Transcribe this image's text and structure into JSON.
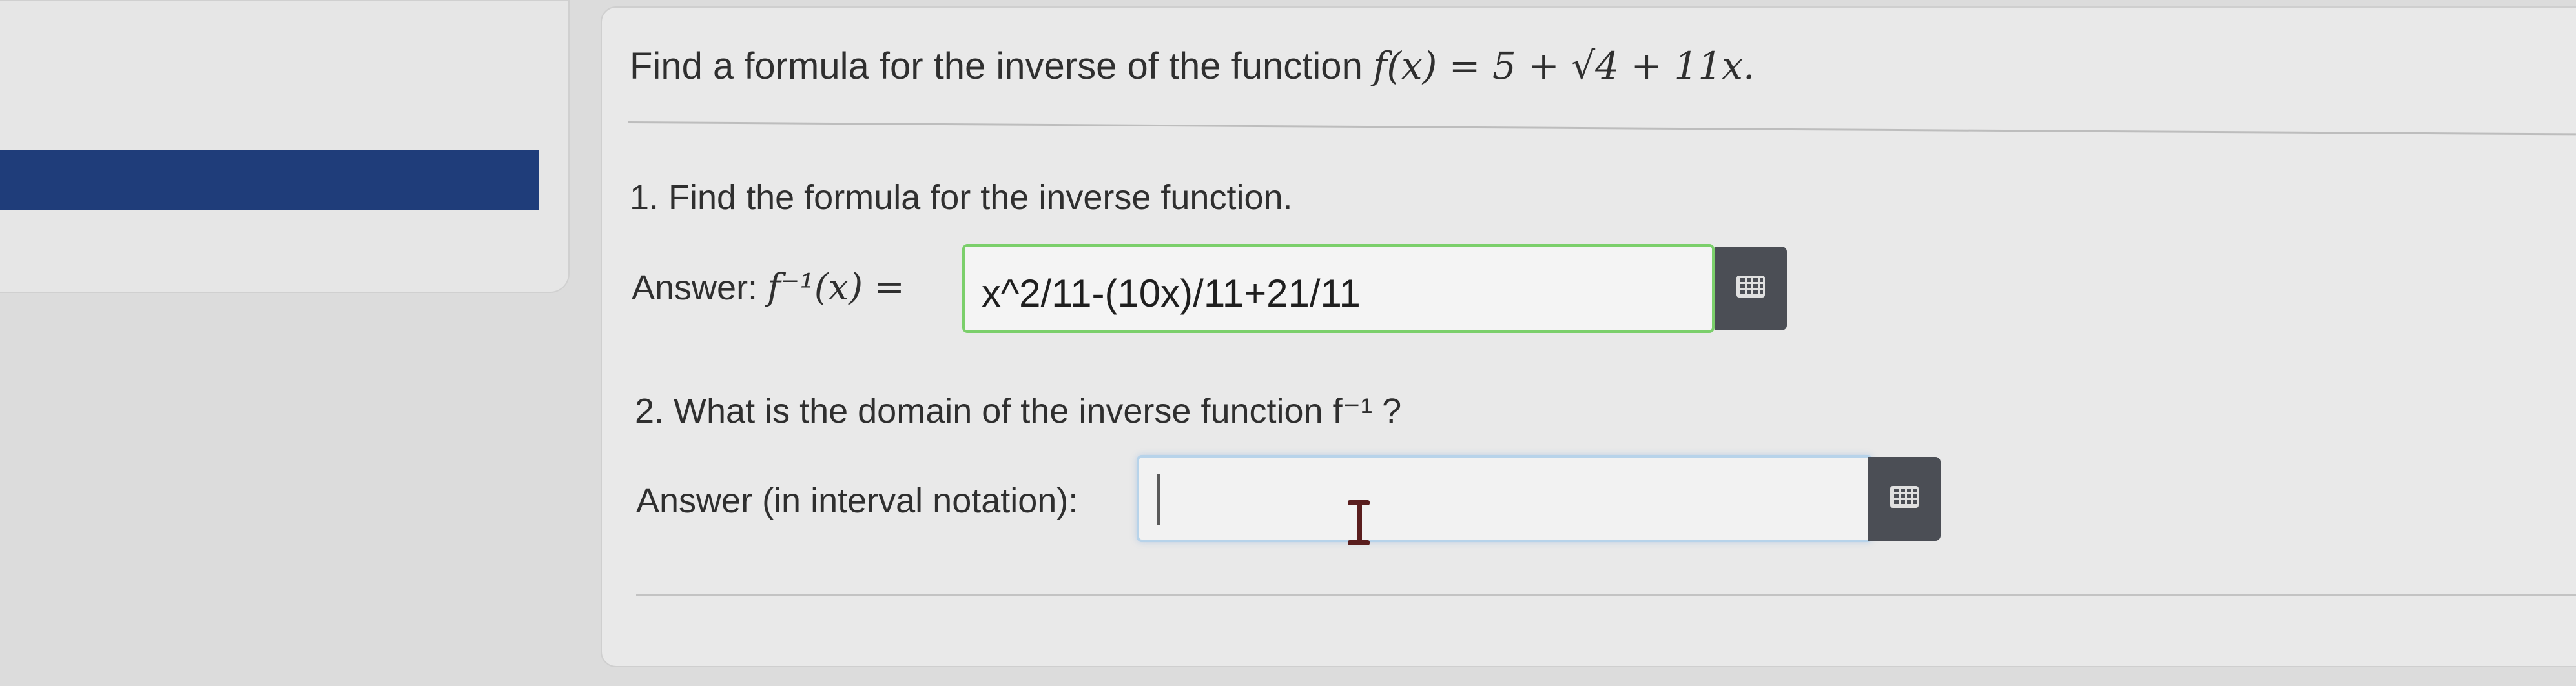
{
  "question": {
    "intro": "Find a formula for the inverse of the function ",
    "function": "f(x) = 5 + √4 + 11x."
  },
  "part1": {
    "prompt": "1. Find the formula for the inverse function.",
    "answer_label": "Answer: ",
    "answer_math": "f⁻¹(x) = ",
    "answer_value": "x^2/11-(10x)/11+21/11"
  },
  "part2": {
    "prompt": "2. What is the domain of the inverse function f⁻¹ ?",
    "answer_label": "Answer (in interval notation):",
    "answer_value": ""
  },
  "icons": {
    "math_keyboard": "keyboard-icon",
    "text_cursor": "i-beam-cursor"
  },
  "colors": {
    "nav_bar": "#1f3d7a",
    "input_valid_border": "#7bcf6b",
    "input_focus_border": "#b7d3ea",
    "keyboard_button": "#4b4e55"
  }
}
